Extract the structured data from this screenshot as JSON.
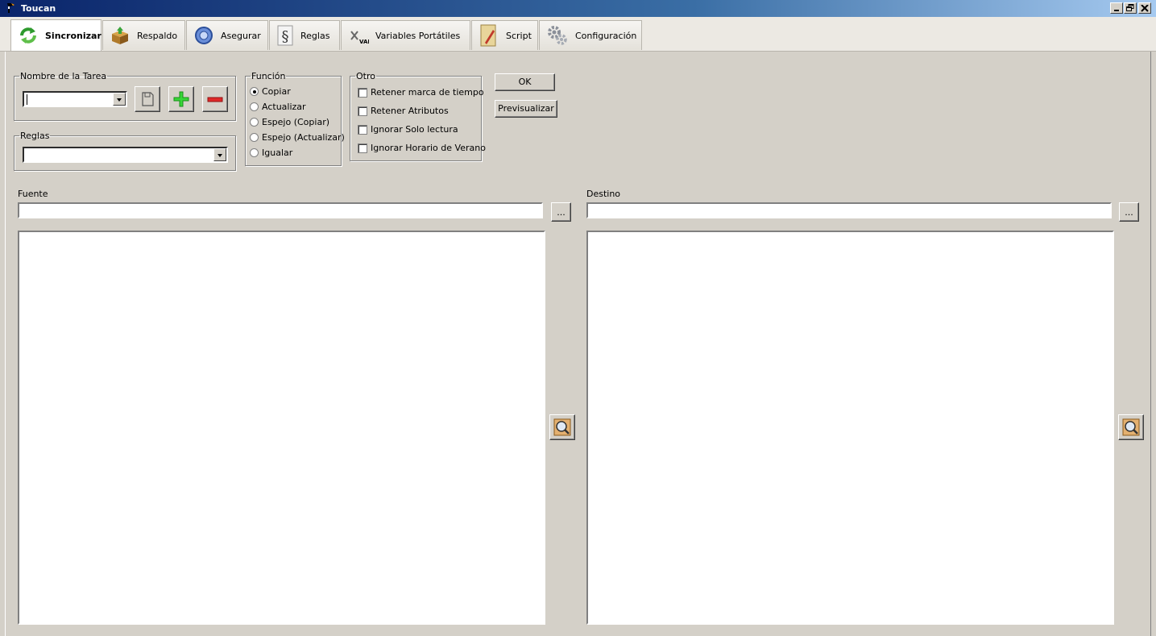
{
  "window": {
    "title": "Toucan",
    "controls": [
      "minimize-icon",
      "restore-icon",
      "close-icon"
    ]
  },
  "tabs": [
    {
      "label": "Sincronizar",
      "icon": "sync-arrows-icon",
      "active": true
    },
    {
      "label": "Respaldo",
      "icon": "package-box-icon",
      "active": false
    },
    {
      "label": "Asegurar",
      "icon": "shield-icon",
      "active": false
    },
    {
      "label": "Reglas",
      "icon": "section-sign-icon",
      "active": false
    },
    {
      "label": "Variables Portátiles",
      "icon": "var-icon",
      "active": false
    },
    {
      "label": "Script",
      "icon": "script-pencil-icon",
      "active": false
    },
    {
      "label": "Configuración",
      "icon": "gears-icon",
      "active": false
    }
  ],
  "task": {
    "legend": "Nombre de la Tarea",
    "value": "",
    "save_icon": "save-disk-icon",
    "add_icon": "plus-icon",
    "remove_icon": "minus-icon"
  },
  "rules": {
    "legend": "Reglas",
    "value": ""
  },
  "function": {
    "legend": "Función",
    "options": [
      {
        "label": "Copiar",
        "selected": true
      },
      {
        "label": "Actualizar",
        "selected": false
      },
      {
        "label": "Espejo (Copiar)",
        "selected": false
      },
      {
        "label": "Espejo (Actualizar)",
        "selected": false
      },
      {
        "label": "Igualar",
        "selected": false
      }
    ]
  },
  "other": {
    "legend": "Otro",
    "options": [
      {
        "label": "Retener marca de tiempo",
        "checked": false
      },
      {
        "label": "Retener Atributos",
        "checked": false
      },
      {
        "label": "Ignorar Solo lectura",
        "checked": false
      },
      {
        "label": "Ignorar Horario de Verano",
        "checked": false
      }
    ]
  },
  "actions": {
    "ok_label": "OK",
    "preview_label": "Previsualizar"
  },
  "source": {
    "label": "Fuente",
    "value": "",
    "browse_label": "...",
    "expand_icon": "magnifier-icon"
  },
  "destination": {
    "label": "Destino",
    "value": "",
    "browse_label": "...",
    "expand_icon": "magnifier-icon"
  }
}
